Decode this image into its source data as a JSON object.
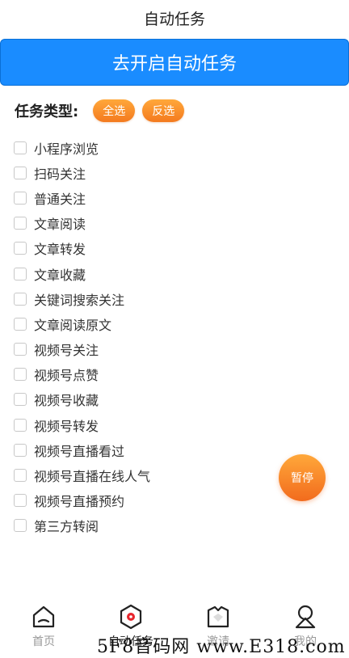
{
  "header": {
    "title": "自动任务"
  },
  "start_button": {
    "label": "去开启自动任务"
  },
  "task_type": {
    "label": "任务类型:",
    "select_all": "全选",
    "invert": "反选"
  },
  "tasks": [
    {
      "label": "小程序浏览",
      "checked": false
    },
    {
      "label": "扫码关注",
      "checked": false
    },
    {
      "label": "普通关注",
      "checked": false
    },
    {
      "label": "文章阅读",
      "checked": false
    },
    {
      "label": "文章转发",
      "checked": false
    },
    {
      "label": "文章收藏",
      "checked": false
    },
    {
      "label": "关键词搜索关注",
      "checked": false
    },
    {
      "label": "文章阅读原文",
      "checked": false
    },
    {
      "label": "视频号关注",
      "checked": false
    },
    {
      "label": "视频号点赞",
      "checked": false
    },
    {
      "label": "视频号收藏",
      "checked": false
    },
    {
      "label": "视频号转发",
      "checked": false
    },
    {
      "label": "视频号直播看过",
      "checked": false
    },
    {
      "label": "视频号直播在线人气",
      "checked": false
    },
    {
      "label": "视频号直播预约",
      "checked": false
    },
    {
      "label": "第三方转阅",
      "checked": false
    }
  ],
  "pause_button": {
    "label": "暂停"
  },
  "tab_bar": {
    "items": [
      {
        "label": "首页",
        "icon": "home-icon",
        "active": false
      },
      {
        "label": "自动任务",
        "icon": "auto-task-icon",
        "active": true
      },
      {
        "label": "邀请",
        "icon": "invite-icon",
        "active": false
      },
      {
        "label": "我的",
        "icon": "profile-icon",
        "active": false
      }
    ]
  },
  "watermark": {
    "text": "5F8音码网 www.E318.com"
  },
  "colors": {
    "primary_blue": "#1a8cff",
    "accent_orange": "#f47a1f",
    "active_icon_red": "#e8262d"
  }
}
